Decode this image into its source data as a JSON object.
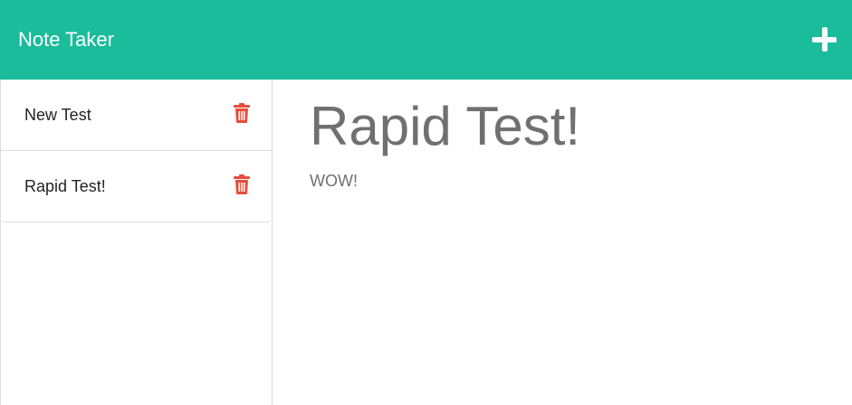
{
  "navbar": {
    "title": "Note Taker",
    "add_icon": "plus-icon",
    "color": "#1abc9c"
  },
  "sidebar": {
    "notes": [
      {
        "title": "New Test",
        "delete_icon": "trash-icon"
      },
      {
        "title": "Rapid Test!",
        "delete_icon": "trash-icon"
      }
    ],
    "delete_color": "#e74c3c"
  },
  "active_note": {
    "title": "Rapid Test!",
    "text": "WOW!"
  }
}
